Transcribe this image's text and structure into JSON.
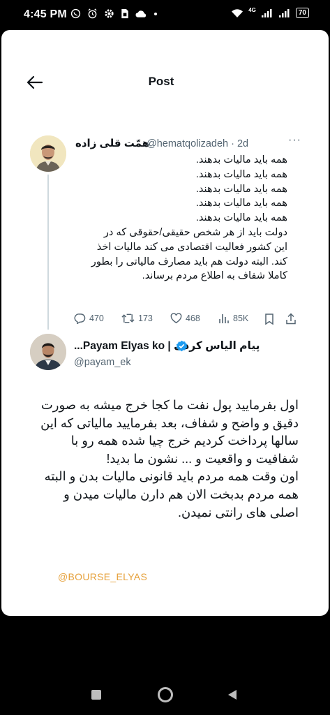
{
  "status_bar": {
    "time": "4:45 PM",
    "network": "4G",
    "battery": "70",
    "icons": [
      "whatsapp-icon",
      "alarm-icon",
      "settings-icon",
      "sim-icon",
      "cloud-icon",
      "wifi-icon",
      "signal-icon",
      "battery-icon"
    ]
  },
  "header": {
    "title": "Post",
    "back_icon": "arrow-left-icon"
  },
  "tweet1": {
    "name": "همّت قلی زاده",
    "handle_time": "@hematqolizadeh · 2d",
    "lines": [
      "همه باید مالیات بدهند.",
      "همه باید مالیات بدهند.",
      "همه باید مالیات بدهند.",
      "همه باید مالیات بدهند.",
      "همه باید مالیات بدهند.",
      "دولت باید از هر شخص حقیقی/حقوقی که در",
      "این کشور فعالیت اقتصادی می کند مالیات اخذ",
      "کند. البته دولت هم باید مصارف مالیاتی را بطور",
      "کاملا شفاف به اطلاع مردم برساند."
    ],
    "stats": {
      "replies": "470",
      "reposts": "173",
      "likes": "468",
      "views": "85K"
    }
  },
  "tweet2": {
    "name": "پیام الیاس کردی | Payam Elyas ko...",
    "handle": "@payam_ek",
    "lines": [
      "اول بفرمایید پول نفت ما کجا خرج میشه به صورت",
      "دقیق و واضح و شفاف، بعد بفرمایید مالیاتی که این",
      "سالها پرداخت کردیم خرج چیا شده همه رو با",
      "شفافیت و واقعیت و ... نشون ما بدید!",
      "اون وقت همه مردم باید قانونی مالیات بدن و البته",
      "همه مردم بدبخت الان هم دارن مالیات میدن و",
      "اصلی های رانتی نمیدن."
    ]
  },
  "watermark": "@BOURSE_ELYAS",
  "colors": {
    "accent": "#1d9bf0",
    "text": "#0f1419",
    "muted": "#536471",
    "watermark": "#e6a13b"
  }
}
